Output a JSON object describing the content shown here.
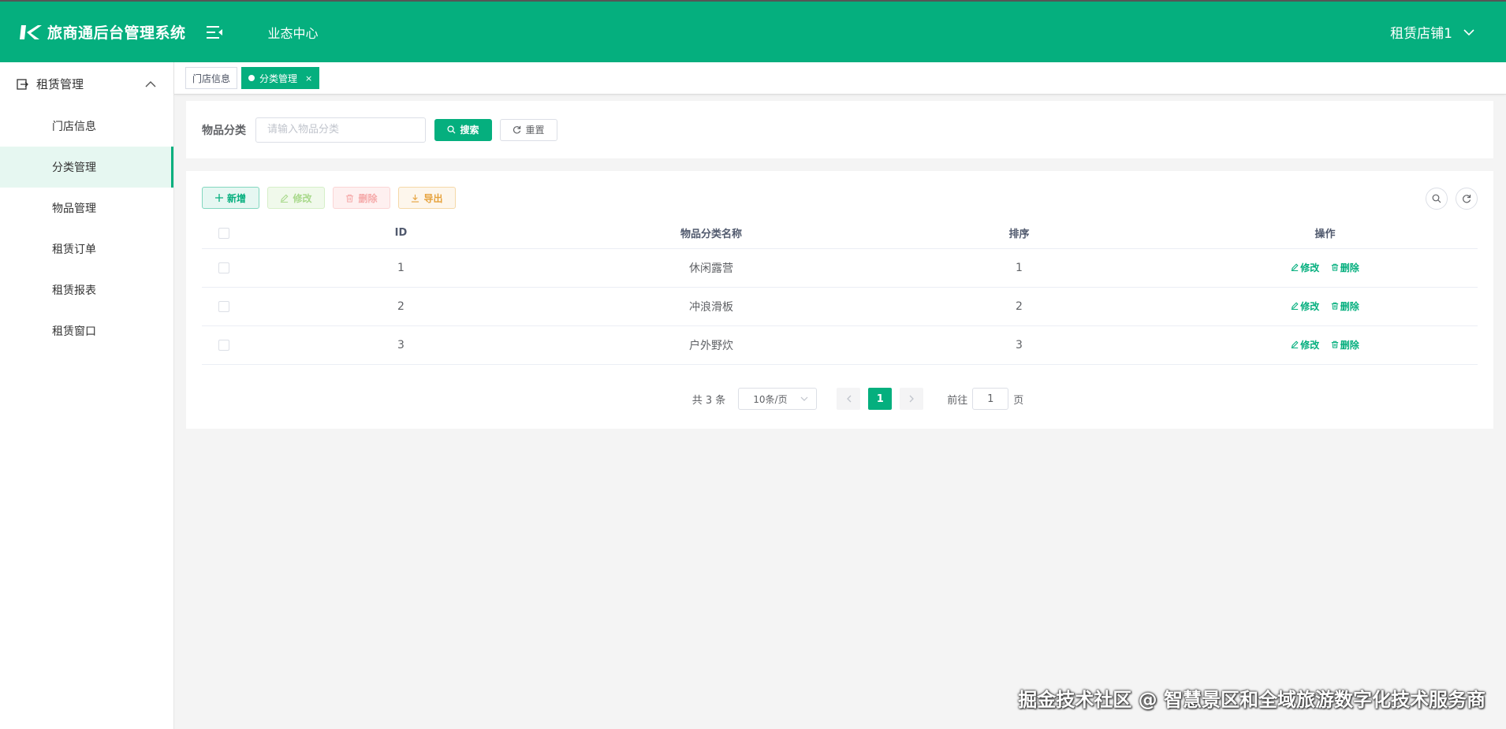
{
  "header": {
    "app_title": "旅商通后台管理系统",
    "nav_center": "业态中心",
    "user_store": "租赁店铺1",
    "brand_color": "#05af7e"
  },
  "sidebar": {
    "group_label": "租赁管理",
    "items": [
      {
        "label": "门店信息",
        "active": false
      },
      {
        "label": "分类管理",
        "active": true
      },
      {
        "label": "物品管理",
        "active": false
      },
      {
        "label": "租赁订单",
        "active": false
      },
      {
        "label": "租赁报表",
        "active": false
      },
      {
        "label": "租赁窗口",
        "active": false
      }
    ]
  },
  "tabs": [
    {
      "label": "门店信息",
      "active": false
    },
    {
      "label": "分类管理",
      "active": true,
      "close": "×"
    }
  ],
  "search": {
    "label": "物品分类",
    "placeholder": "请输入物品分类",
    "value": "",
    "search_label": "搜索",
    "reset_label": "重置"
  },
  "toolbar": {
    "add_label": "新增",
    "edit_label": "修改",
    "delete_label": "删除",
    "export_label": "导出"
  },
  "table": {
    "columns": [
      "ID",
      "物品分类名称",
      "排序",
      "操作"
    ],
    "rows": [
      {
        "id": "1",
        "name": "休闲露营",
        "sort": "1"
      },
      {
        "id": "2",
        "name": "冲浪滑板",
        "sort": "2"
      },
      {
        "id": "3",
        "name": "户外野炊",
        "sort": "3"
      }
    ],
    "op_edit": "修改",
    "op_delete": "删除"
  },
  "pagination": {
    "total": "共 3 条",
    "page_size": "10条/页",
    "current_page": "1",
    "goto_prefix": "前往",
    "goto_value": "1",
    "goto_suffix": "页"
  },
  "watermark": "掘金技术社区 @ 智慧景区和全域旅游数字化技术服务商"
}
